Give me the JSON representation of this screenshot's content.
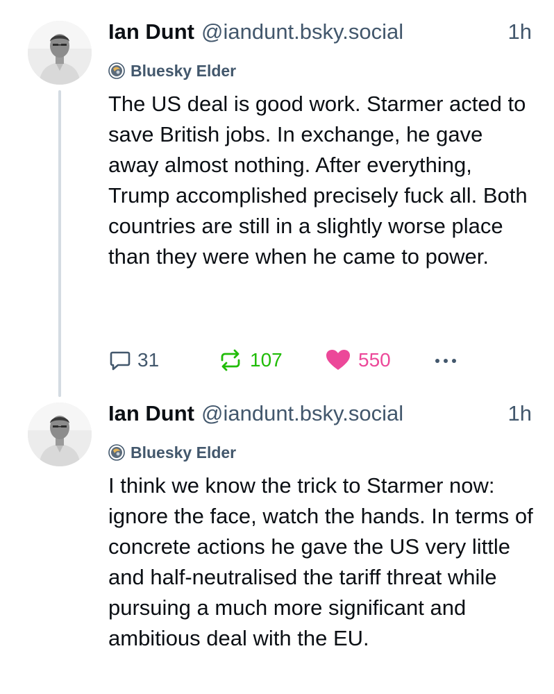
{
  "posts": [
    {
      "author": {
        "display_name": "Ian Dunt",
        "handle": "@iandunt.bsky.social",
        "badge": "Bluesky Elder",
        "avatar_icon": "avatar-photo"
      },
      "timestamp": "1h",
      "text": "The US deal is good work. Starmer acted to save British jobs. In exchange, he gave away almost nothing. After everything, Trump accomplished precisely fuck all. Both countries are still in a slightly worse place than they were when he came to power.",
      "actions": {
        "reply_count": "31",
        "repost_count": "107",
        "like_count": "550",
        "reply_icon": "speech-bubble-icon",
        "repost_icon": "repost-arrows-icon",
        "like_icon": "heart-icon",
        "more_icon": "ellipsis-icon"
      }
    },
    {
      "author": {
        "display_name": "Ian Dunt",
        "handle": "@iandunt.bsky.social",
        "badge": "Bluesky Elder",
        "avatar_icon": "avatar-photo"
      },
      "timestamp": "1h",
      "text": "I think we know the trick to Starmer now: ignore the face, watch the hands. In terms of concrete actions he gave the US very little and half-neutralised the tariff threat while pursuing a much more significant and ambitious deal with the EU."
    }
  ],
  "colors": {
    "repost_active": "#20bc07",
    "like_active": "#ec4899",
    "secondary_text": "#42576c",
    "thread_line": "#d4dbe2"
  }
}
